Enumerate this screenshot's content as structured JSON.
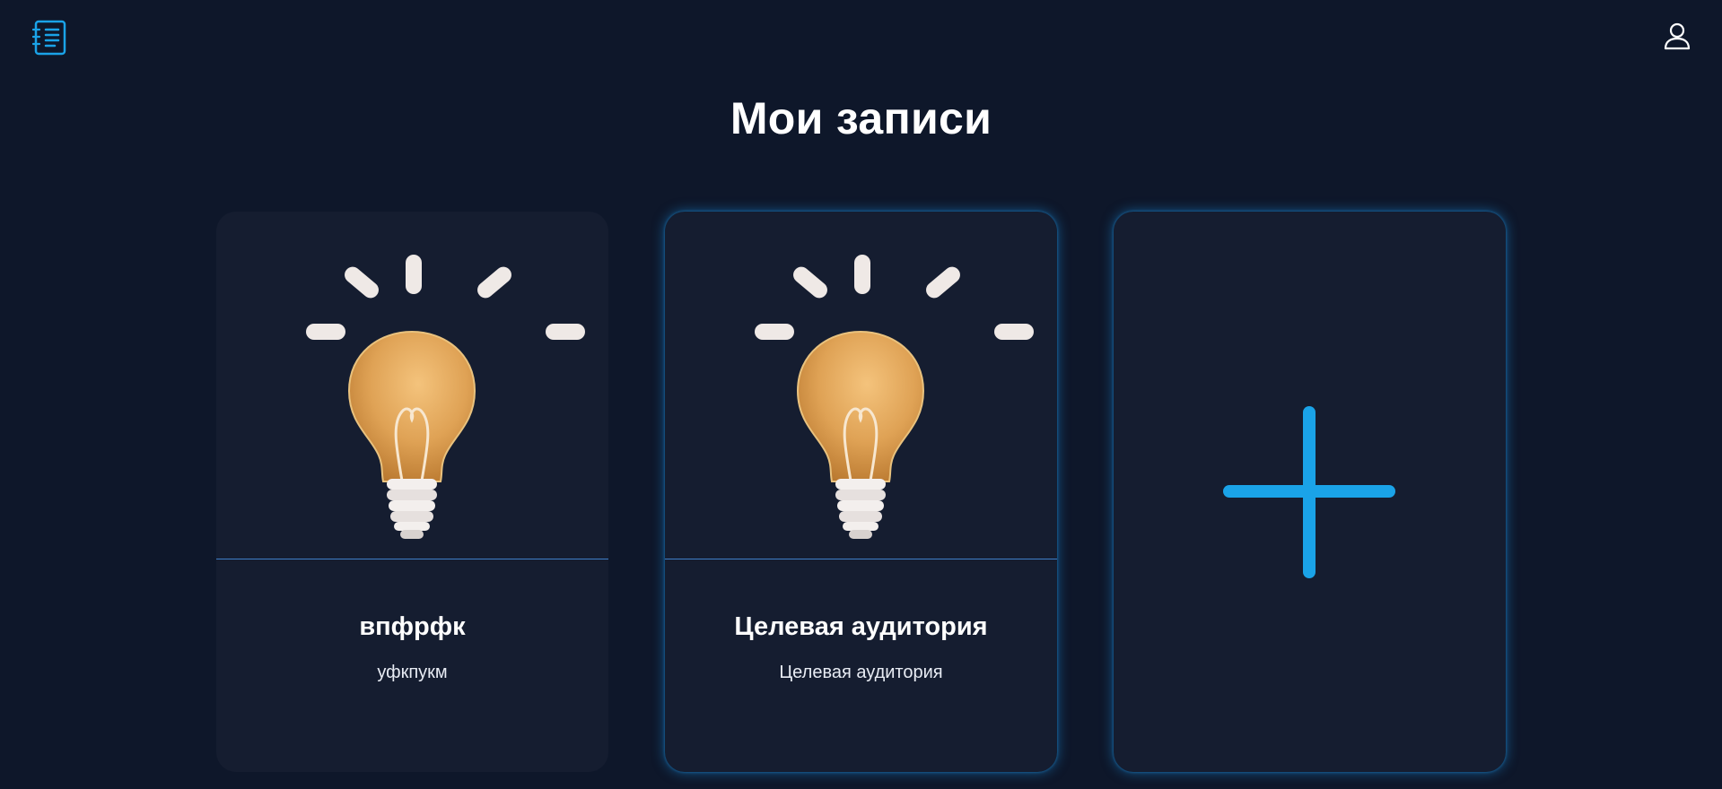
{
  "header": {
    "logo_icon": "notebook-list-icon",
    "profile_icon": "user-icon",
    "accent_color": "#1aa3e8"
  },
  "page": {
    "title": "Мои записи"
  },
  "notes": [
    {
      "title": "впфрфк",
      "subtitle": "уфкпукм",
      "image_icon": "lightbulb-icon"
    },
    {
      "title": "Целевая аудитория",
      "subtitle": "Целевая аудитория",
      "image_icon": "lightbulb-icon"
    }
  ],
  "add_card": {
    "icon": "plus-icon",
    "color": "#1aa3e8"
  }
}
